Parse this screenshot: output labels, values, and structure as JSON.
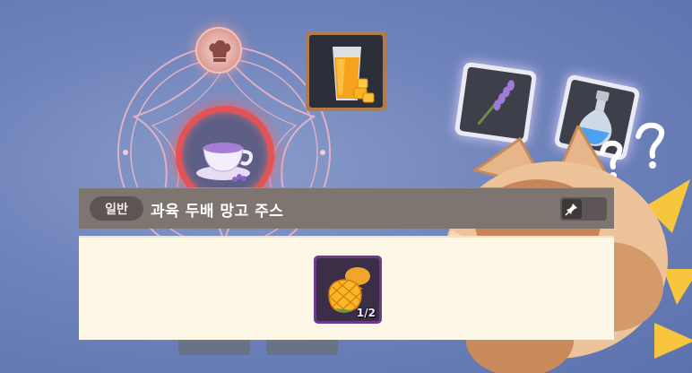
{
  "panel": {
    "grade_label": "일반",
    "item_name": "과육 두배 망고 주스",
    "pin_icon": "pin-icon"
  },
  "ingredients": [
    {
      "name": "mango-icon",
      "count_text": "1/2"
    }
  ],
  "scene": {
    "result_item_icon": "mango-juice-icon",
    "current_recipe_icon": "lavender-tea-icon",
    "badge_icon": "chef-hat-icon",
    "floating_items": [
      "lavender-icon",
      "potion-bottle-icon"
    ],
    "accent_colors": {
      "magic_ring": "#e25355",
      "ingredient_frame": "#6c3a8a",
      "result_frame": "#b37a4a"
    }
  }
}
